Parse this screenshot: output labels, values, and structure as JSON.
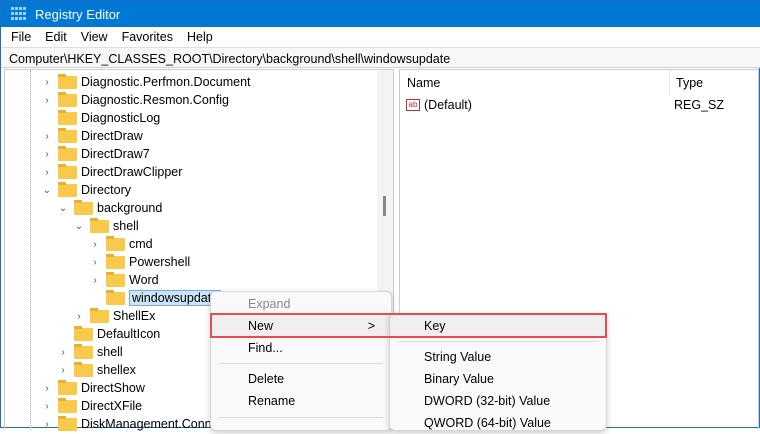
{
  "window": {
    "title": "Registry Editor"
  },
  "menu": [
    "File",
    "Edit",
    "View",
    "Favorites",
    "Help"
  ],
  "address": "Computer\\HKEY_CLASSES_ROOT\\Directory\\background\\shell\\windowsupdate",
  "tree": [
    {
      "label": "Diagnostic.Perfmon.Document",
      "chev": ">"
    },
    {
      "label": "Diagnostic.Resmon.Config",
      "chev": ">"
    },
    {
      "label": "DiagnosticLog",
      "chev": ""
    },
    {
      "label": "DirectDraw",
      "chev": ">"
    },
    {
      "label": "DirectDraw7",
      "chev": ">"
    },
    {
      "label": "DirectDrawClipper",
      "chev": ">"
    },
    {
      "label": "Directory",
      "chev": "v"
    },
    {
      "label": "background",
      "chev": "v"
    },
    {
      "label": "shell",
      "chev": "v"
    },
    {
      "label": "cmd",
      "chev": ">"
    },
    {
      "label": "Powershell",
      "chev": ">"
    },
    {
      "label": "Word",
      "chev": ">"
    },
    {
      "label": "windowsupdate",
      "chev": ""
    },
    {
      "label": "ShellEx",
      "chev": ">"
    },
    {
      "label": "DefaultIcon",
      "chev": ""
    },
    {
      "label": "shell",
      "chev": ">"
    },
    {
      "label": "shellex",
      "chev": ">"
    },
    {
      "label": "DirectShow",
      "chev": ">"
    },
    {
      "label": "DirectXFile",
      "chev": ">"
    },
    {
      "label": "DiskManagement.Conne",
      "chev": ">"
    }
  ],
  "values": {
    "col_name": "Name",
    "col_type": "Type",
    "rows": [
      {
        "name": "(Default)",
        "type": "REG_SZ"
      }
    ]
  },
  "context_menu": {
    "expand": "Expand",
    "new": "New",
    "new_arrow": ">",
    "find": "Find...",
    "delete": "Delete",
    "rename": "Rename"
  },
  "submenu": {
    "key": "Key",
    "string": "String Value",
    "binary": "Binary Value",
    "dword": "DWORD (32-bit) Value",
    "qword": "QWORD (64-bit) Value"
  }
}
